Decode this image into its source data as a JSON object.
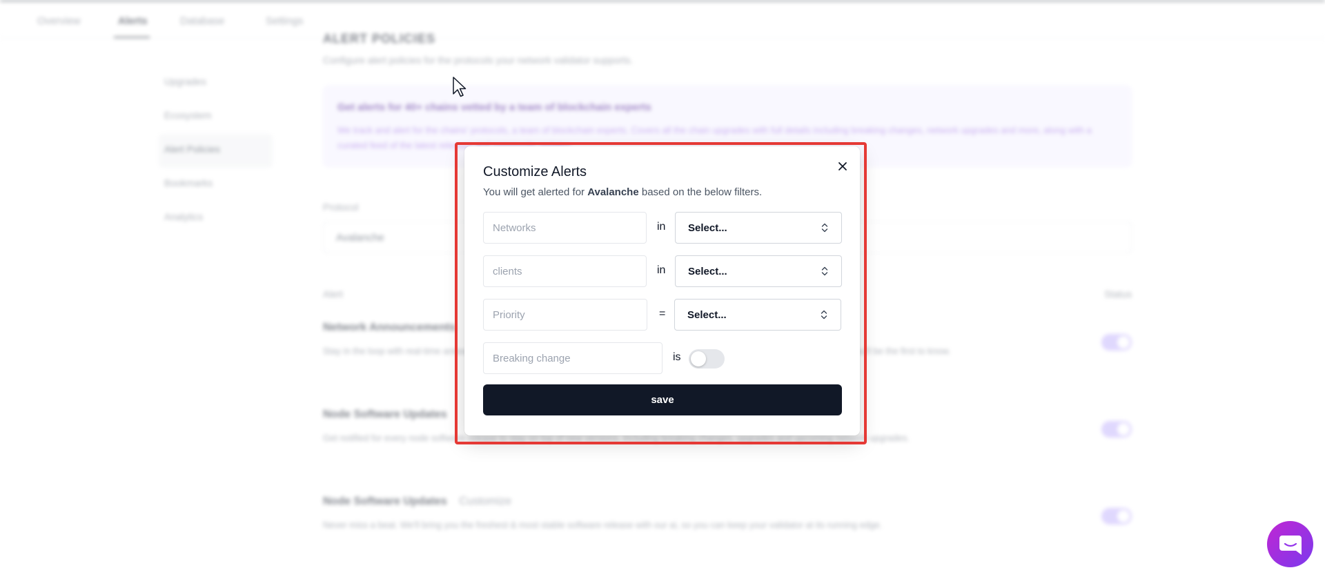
{
  "background": {
    "nav_tabs": [
      "Overview",
      "Alerts",
      "Database",
      "Settings"
    ],
    "sidebar_items": [
      "Upgrades",
      "Ecosystem",
      "Alert Policies",
      "Bookmarks",
      "Analytics"
    ],
    "page_title": "ALERT POLICIES",
    "page_subtitle": "Configure alert policies for the protocols your network validator supports.",
    "banner_title": "Get alerts for 40+ chains vetted by a team of blockchain experts",
    "banner_body": "We track and alert for the chains' protocols, a team of blockchain experts. Covers all the chain upgrades with full details including breaking changes, network upgrades and more, along with a curated feed of the latest releases and community updates.",
    "protocol_label": "Protocol",
    "protocol_value": "Avalanche",
    "table_col_alert": "Alert",
    "table_col_status": "Status",
    "rows": [
      {
        "title": "Network Announcements",
        "desc": "Stay in the loop with real-time announcements about network changes, governance votes, and other important news about the chain you'll be the first to know."
      },
      {
        "title": "Node Software Updates",
        "desc": "Get notified for every node software release to stay on top of new versions, including breaking changes, upgrades and upcoming network upgrades."
      },
      {
        "title": "Node Software Updates",
        "badge": "Customize",
        "desc": "Never miss a beat. We'll bring you the freshest & most stable software release with our ai, so you can keep your validator at its running edge."
      }
    ]
  },
  "modal": {
    "title": "Customize Alerts",
    "subtitle_prefix": "You will get alerted for ",
    "subtitle_protocol": "Avalanche",
    "subtitle_suffix": " based on the below filters.",
    "filters": [
      {
        "field_placeholder": "Networks",
        "operator": "in",
        "select_value": "Select..."
      },
      {
        "field_placeholder": "clients",
        "operator": "in",
        "select_value": "Select..."
      },
      {
        "field_placeholder": "Priority",
        "operator": "=",
        "select_value": "Select..."
      }
    ],
    "breaking_change": {
      "field_placeholder": "Breaking change",
      "operator": "is",
      "toggle_on": false
    },
    "save_label": "save"
  },
  "colors": {
    "highlight_border": "#e53935",
    "save_button_bg": "#111827",
    "chat_gradient_start": "#c026d3",
    "chat_gradient_end": "#7c3aed"
  },
  "icons": {
    "close": "close-icon",
    "select_chevron": "chevron-up-down-icon",
    "cursor": "mouse-pointer-icon",
    "chat": "chat-bubble-icon"
  }
}
